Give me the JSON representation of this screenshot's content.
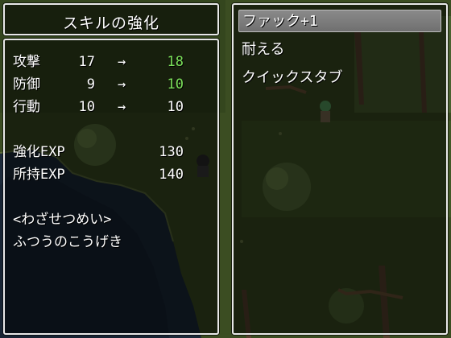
{
  "title": "スキルの強化",
  "stats": [
    {
      "label": "攻撃",
      "current": "17",
      "arrow": "→",
      "next": "18",
      "improved": true
    },
    {
      "label": "防御",
      "current": "9",
      "arrow": "→",
      "next": "10",
      "improved": true
    },
    {
      "label": "行動",
      "current": "10",
      "arrow": "→",
      "next": "10",
      "improved": false
    }
  ],
  "exp": [
    {
      "label": "強化EXP",
      "value": "130"
    },
    {
      "label": "所持EXP",
      "value": "140"
    }
  ],
  "description": {
    "heading": "<わざせつめい>",
    "text": "ふつうのこうげき"
  },
  "skills": [
    {
      "label": "ファック+1",
      "selected": true
    },
    {
      "label": "耐える",
      "selected": false
    },
    {
      "label": "クイックスタブ",
      "selected": false
    }
  ],
  "colors": {
    "improved_value": "#7be05a",
    "window_border": "#e8e8e8",
    "selection": "#7a7a7a"
  }
}
